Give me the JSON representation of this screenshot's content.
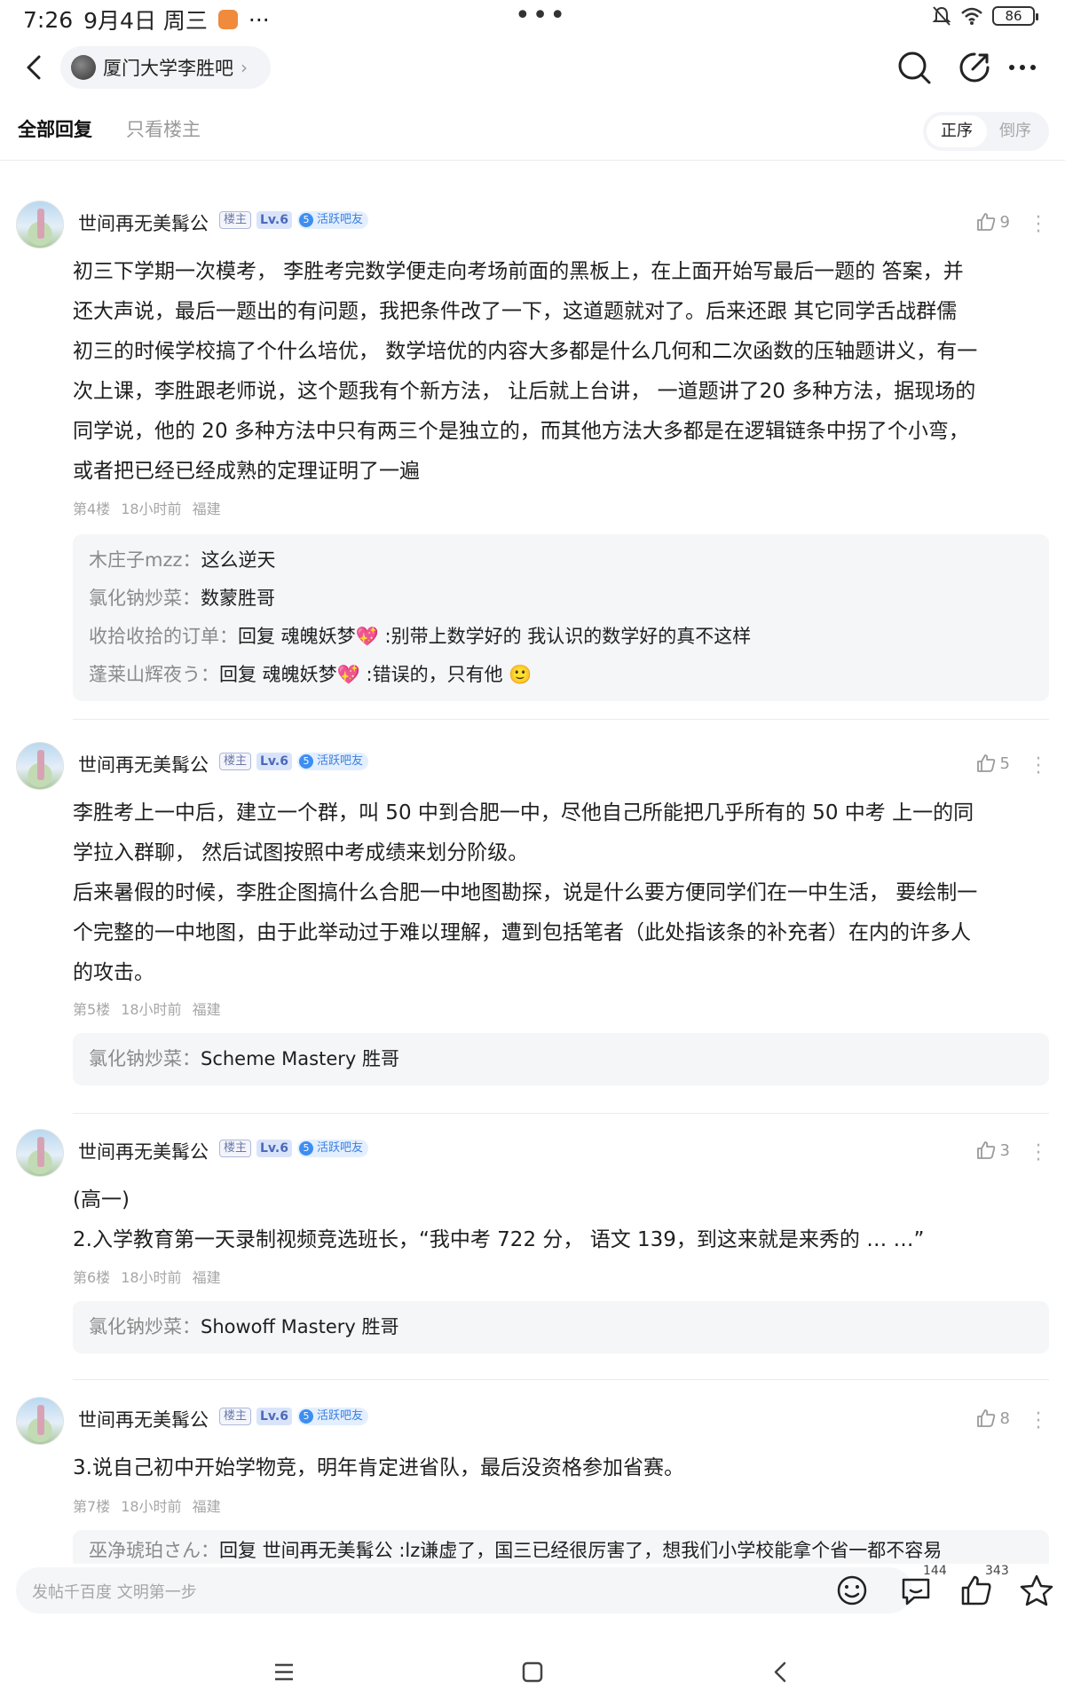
{
  "status_bar": {
    "time": "7:26",
    "date": "9月4日 周三",
    "dots": "···",
    "center_dots": "•••",
    "battery": "86"
  },
  "nav": {
    "forum_name": "厦门大学李胜吧",
    "chevron": "›"
  },
  "tabs": {
    "all_replies": "全部回复",
    "host_only": "只看楼主",
    "order_asc": "正序",
    "order_desc": "倒序"
  },
  "posts": [
    {
      "username": "世间再无美髯公",
      "host_badge": "楼主",
      "level": "Lv.6",
      "active_num": "5",
      "active_label": "活跃吧友",
      "likes": "9",
      "lines": [
        "初三下学期一次模考， 李胜考完数学便走向考场前面的黑板上，在上面开始写最后一题的 答案，并",
        "还大声说，最后一题出的有问题，我把条件改了一下，这道题就对了。后来还跟 其它同学舌战群儒",
        "初三的时候学校搞了个什么培优， 数学培优的内容大多都是什么几何和二次函数的压轴题讲义，有一",
        "次上课，李胜跟老师说，这个题我有个新方法， 让后就上台讲， 一道题讲了20 多种方法，据现场的",
        "同学说，他的 20 多种方法中只有两三个是独立的，而其他方法大多都是在逻辑链条中拐了个小弯，",
        "或者把已经已经成熟的定理证明了一遍"
      ],
      "floor": "第4楼",
      "time": "18小时前",
      "location": "福建",
      "replies": [
        {
          "name": "木庄子mzz：",
          "text": "这么逆天"
        },
        {
          "name": "氯化钠炒菜：",
          "text": "数蒙胜哥"
        },
        {
          "name": "收拾收拾的订单：",
          "text": "回复 魂魄妖梦💖 :别带上数学好的 我认识的数学好的真不这样"
        },
        {
          "name": "蓬莱山辉夜う：",
          "text": "回复 魂魄妖梦💖 :错误的，只有他 🙂"
        }
      ]
    },
    {
      "username": "世间再无美髯公",
      "host_badge": "楼主",
      "level": "Lv.6",
      "active_num": "5",
      "active_label": "活跃吧友",
      "likes": "5",
      "lines": [
        "李胜考上一中后，建立一个群，叫 50 中到合肥一中，尽他自己所能把几乎所有的 50 中考 上一的同",
        "学拉入群聊， 然后试图按照中考成绩来划分阶级。",
        "后来暑假的时候，李胜企图搞什么合肥一中地图勘探，说是什么要方便同学们在一中生活， 要绘制一",
        "个完整的一中地图，由于此举动过于难以理解，遭到包括笔者（此处指该条的补充者）在内的许多人",
        "的攻击。"
      ],
      "floor": "第5楼",
      "time": "18小时前",
      "location": "福建",
      "replies": [
        {
          "name": "氯化钠炒菜：",
          "text": "Scheme Mastery 胜哥"
        }
      ]
    },
    {
      "username": "世间再无美髯公",
      "host_badge": "楼主",
      "level": "Lv.6",
      "active_num": "5",
      "active_label": "活跃吧友",
      "likes": "3",
      "lines": [
        "(高一)",
        "2.入学教育第一天录制视频竞选班长，“我中考 722 分， 语文 139，到这来就是来秀的 … …”"
      ],
      "floor": "第6楼",
      "time": "18小时前",
      "location": "福建",
      "replies": [
        {
          "name": "氯化钠炒菜：",
          "text": "Showoff Mastery 胜哥"
        }
      ]
    },
    {
      "username": "世间再无美髯公",
      "host_badge": "楼主",
      "level": "Lv.6",
      "active_num": "5",
      "active_label": "活跃吧友",
      "likes": "8",
      "lines": [
        "3.说自己初中开始学物竞，明年肯定进省队，最后没资格参加省赛。"
      ],
      "floor": "第7楼",
      "time": "18小时前",
      "location": "福建",
      "replies": [
        {
          "name": "巫净琥珀さん：",
          "text": "回复 世间再无美髯公 :lz谦虚了，国三已经很厉害了，想我们小学校能拿个省一都不容易"
        }
      ]
    }
  ],
  "bottom_bar": {
    "placeholder": "发帖千百度 文明第一步",
    "comment_count": "144",
    "like_count": "343"
  }
}
